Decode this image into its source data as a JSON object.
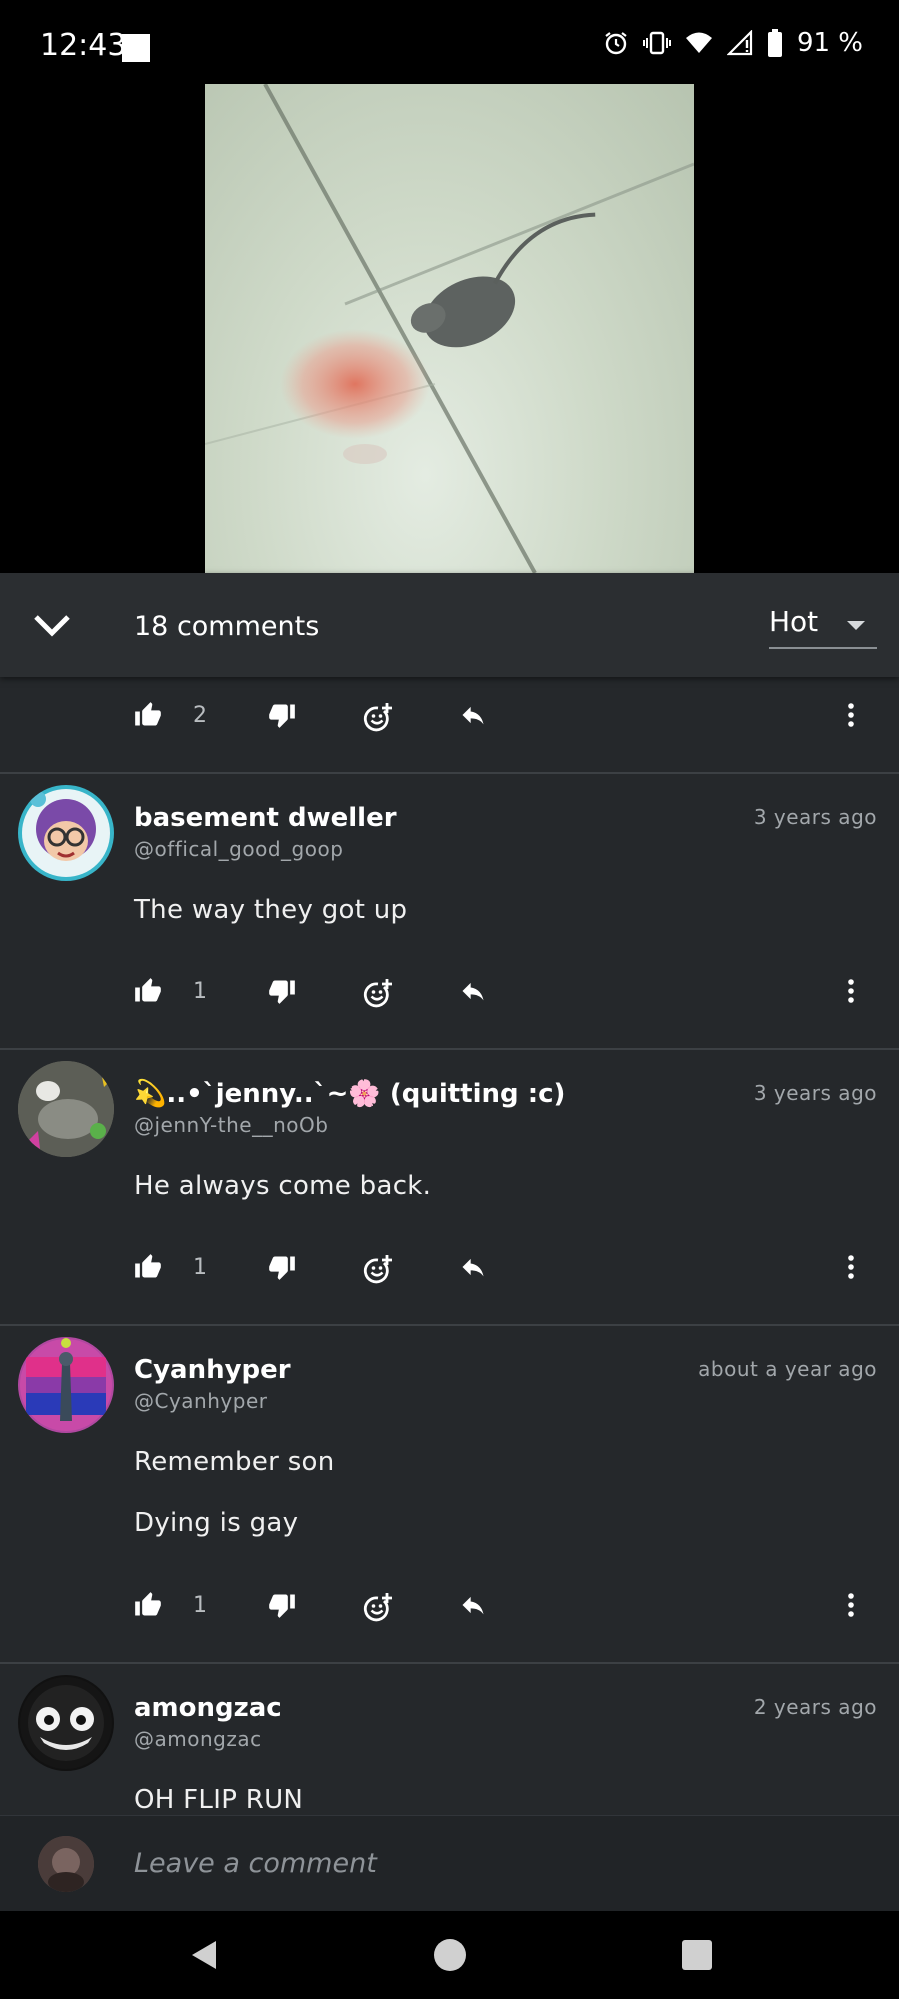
{
  "status_bar": {
    "time": "12:43",
    "battery": "91 %"
  },
  "header": {
    "comment_count": "18 comments",
    "sort": "Hot"
  },
  "partial_comment": {
    "likes": "2"
  },
  "comments": [
    {
      "author": "basement dweller",
      "handle": "@offical_good_goop",
      "time": "3 years ago",
      "lines": [
        "The way they got up"
      ],
      "likes": "1"
    },
    {
      "author": "💫..•`jenny..`~🌸 (quitting :c)",
      "handle": "@jennY-the__noOb",
      "time": "3 years ago",
      "lines": [
        "He always come back."
      ],
      "likes": "1"
    },
    {
      "author": "Cyanhyper",
      "handle": "@Cyanhyper",
      "time": "about a year ago",
      "lines": [
        "Remember son",
        "Dying is gay"
      ],
      "likes": "1"
    },
    {
      "author": "amongzac",
      "handle": "@amongzac",
      "time": "2 years ago",
      "lines": [
        "OH FLIP RUN"
      ]
    }
  ],
  "composer": {
    "placeholder": "Leave a comment"
  },
  "icons": [
    "alarm-icon",
    "vibrate-icon",
    "wifi-icon",
    "signal-icon",
    "battery-icon",
    "chevron-down-icon",
    "thumbs-up-icon",
    "thumbs-down-icon",
    "emoji-reaction-icon",
    "reply-icon",
    "more-vert-icon",
    "back-icon",
    "home-icon",
    "recents-icon"
  ],
  "colors": {
    "panel": "#25282b",
    "header": "#2b2e31",
    "muted_text": "#a2a7ab"
  }
}
